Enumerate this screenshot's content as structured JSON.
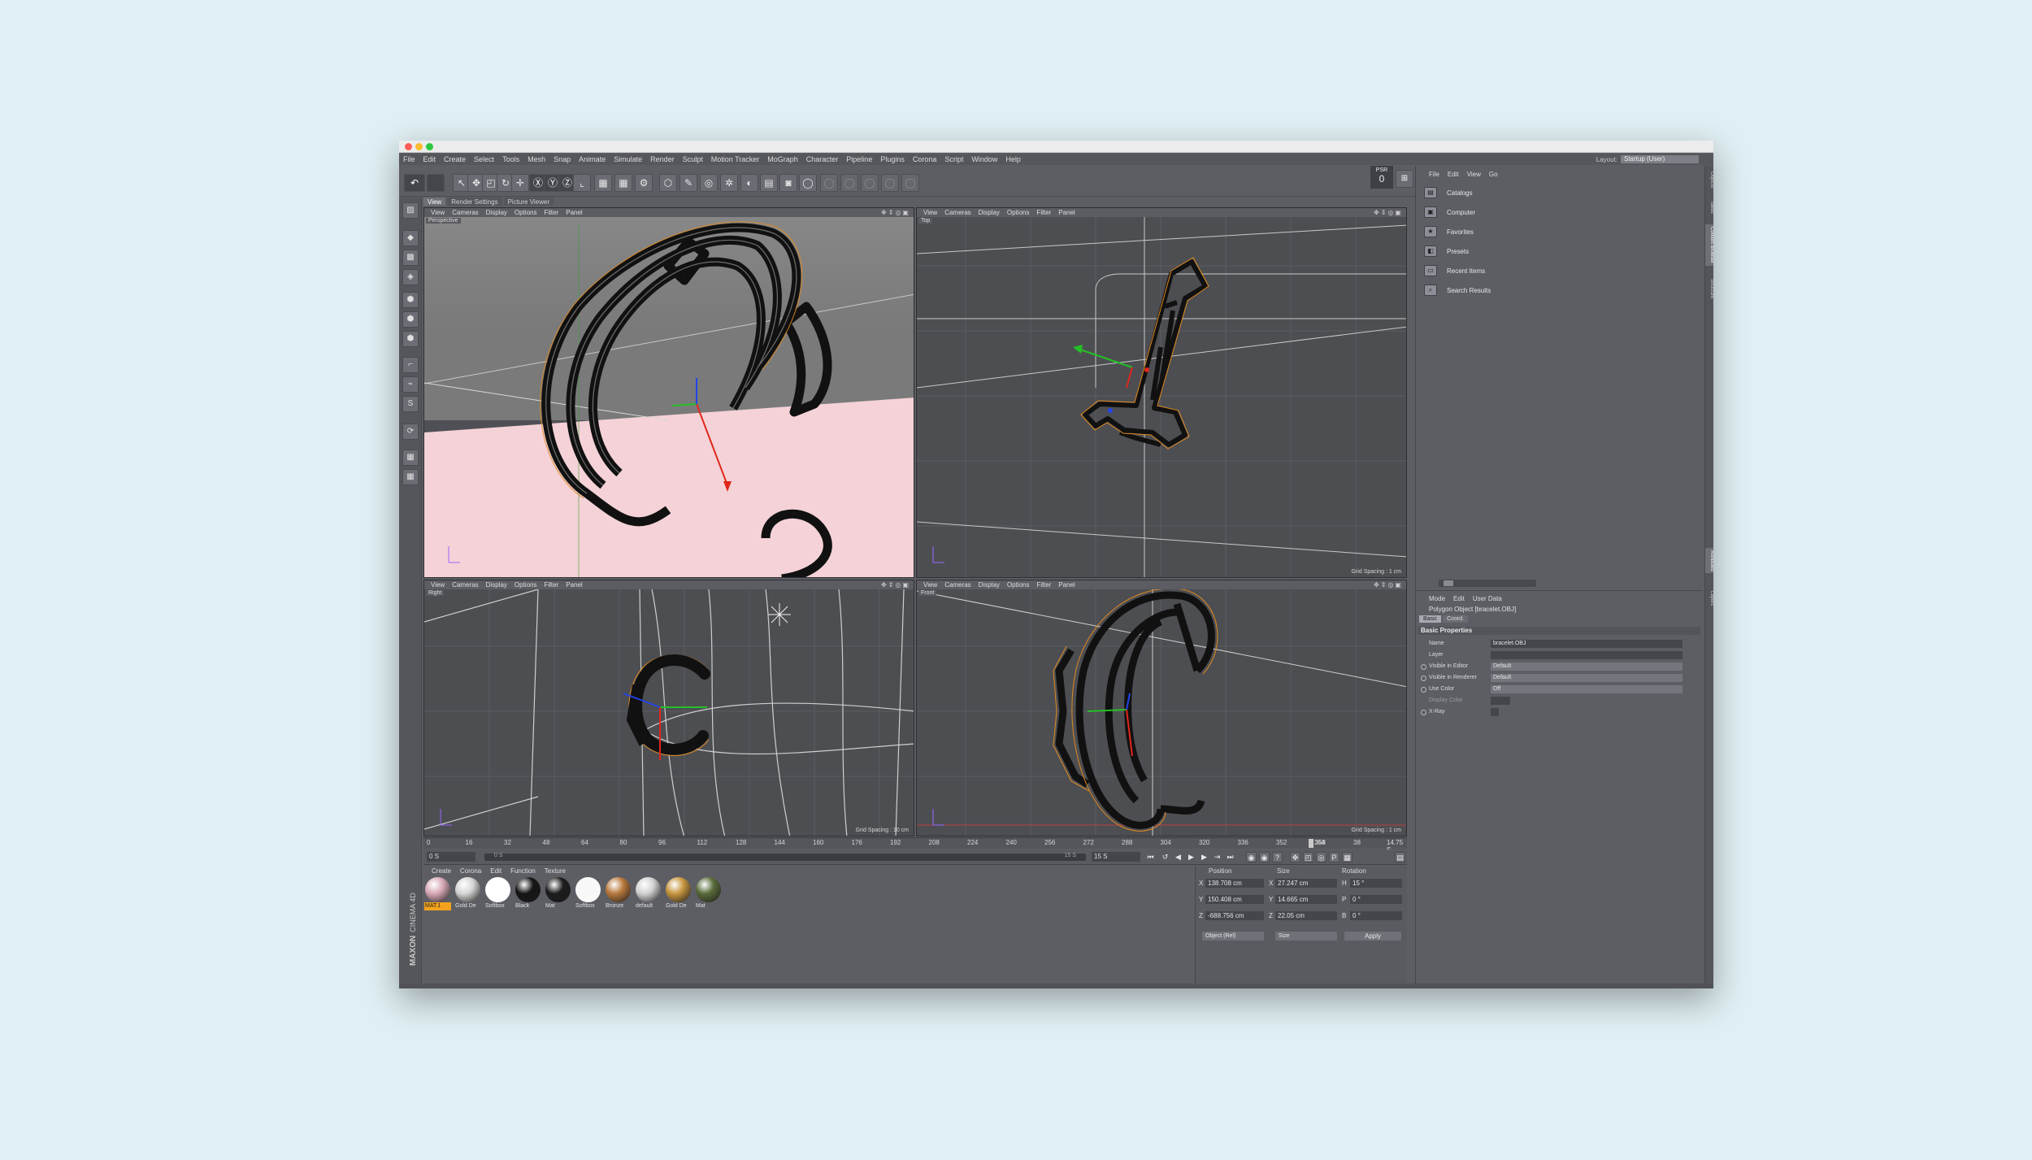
{
  "menubar": [
    "File",
    "Edit",
    "Create",
    "Select",
    "Tools",
    "Mesh",
    "Snap",
    "Animate",
    "Simulate",
    "Render",
    "Sculpt",
    "Motion Tracker",
    "MoGraph",
    "Character",
    "Pipeline",
    "Plugins",
    "Corona",
    "Script",
    "Window",
    "Help"
  ],
  "layout": {
    "label": "Layout:",
    "value": "Startup (User)"
  },
  "psr": {
    "label": "PSR",
    "value": "0"
  },
  "viewport_tabs": [
    "View",
    "Render Settings",
    "Picture Viewer"
  ],
  "viewport_menu": [
    "View",
    "Cameras",
    "Display",
    "Options",
    "Filter",
    "Panel"
  ],
  "viewports": {
    "perspective": {
      "label": "Perspective",
      "footer": ""
    },
    "top": {
      "label": "Top",
      "footer": "Grid Spacing : 1 cm"
    },
    "right": {
      "label": "Right",
      "footer": "Grid Spacing : 10 cm"
    },
    "front": {
      "label": "Front",
      "footer": "Grid Spacing : 1 cm"
    }
  },
  "timeline": {
    "ticks": [
      "0",
      "16",
      "32",
      "48",
      "64",
      "80",
      "96",
      "112",
      "128",
      "144",
      "160",
      "176",
      "192",
      "208",
      "224",
      "240",
      "256",
      "272",
      "288",
      "304",
      "320",
      "336",
      "352",
      "368",
      "38"
    ],
    "current_mark": "354",
    "current_frame": "14.75 S",
    "start": "0 S",
    "slider_start": "0 S",
    "slider_end": "15 S",
    "end": "15 S"
  },
  "material_menu": [
    "Create",
    "Corona",
    "Edit",
    "Function",
    "Texture"
  ],
  "materials": [
    {
      "name": "MAT.1",
      "color": "#d7a9b6",
      "selected": true
    },
    {
      "name": "Gold De",
      "color": "#d5d5d5",
      "selected": false
    },
    {
      "name": "Softbox",
      "color": "#ffffff",
      "selected": false
    },
    {
      "name": "Black",
      "color": "#151515",
      "selected": false
    },
    {
      "name": "Mat",
      "color": "#1c1c1c",
      "selected": false
    },
    {
      "name": "Softbox",
      "color": "#f8f8f8",
      "selected": false
    },
    {
      "name": "Bronze",
      "color": "#b8793d",
      "selected": false
    },
    {
      "name": "default",
      "color": "#d2d2d2",
      "selected": false
    },
    {
      "name": "Gold De",
      "color": "#c7963f",
      "selected": false
    },
    {
      "name": "Mat",
      "color": "#5a6b3a",
      "selected": false
    }
  ],
  "coords": {
    "headers": {
      "position": "Position",
      "size": "Size",
      "rotation": "Rotation"
    },
    "rows": [
      {
        "axis": "X",
        "position": "138.708 cm",
        "size_axis": "X",
        "size": "27.247 cm",
        "rot_axis": "H",
        "rotation": "15 °"
      },
      {
        "axis": "Y",
        "position": "150.408 cm",
        "size_axis": "Y",
        "size": "14.665 cm",
        "rot_axis": "P",
        "rotation": "0 °"
      },
      {
        "axis": "Z",
        "position": "-688.756 cm",
        "size_axis": "Z",
        "size": "22.05 cm",
        "rot_axis": "B",
        "rotation": "0 °"
      }
    ],
    "mode_select": "Object (Rel)",
    "size_select": "Size",
    "apply": "Apply"
  },
  "content_browser": {
    "menu": [
      "File",
      "Edit",
      "View",
      "Go"
    ],
    "items": [
      "Catalogs",
      "Computer",
      "Favorites",
      "Presets",
      "Recent Items",
      "Search Results"
    ]
  },
  "attributes": {
    "menu": [
      "Mode",
      "Edit",
      "User Data"
    ],
    "object": "Polygon Object [bracelet.OBJ]",
    "tabs": [
      "Basic",
      "Coord."
    ],
    "section": "Basic Properties",
    "fields": [
      {
        "label": "Name",
        "value": "bracelet.OBJ",
        "dot": false,
        "dim": false,
        "select": false
      },
      {
        "label": "Layer",
        "value": "",
        "dot": false,
        "dim": false,
        "select": false
      },
      {
        "label": "Visible in Editor",
        "value": "Default",
        "dot": true,
        "dim": false,
        "select": true
      },
      {
        "label": "Visible in Renderer",
        "value": "Default",
        "dot": true,
        "dim": false,
        "select": true
      },
      {
        "label": "Use Color",
        "value": "Off",
        "dot": true,
        "dim": false,
        "select": true
      },
      {
        "label": "Display Color",
        "value": "",
        "dot": false,
        "dim": true,
        "select": false
      },
      {
        "label": "X-Ray",
        "value": "",
        "dot": true,
        "dim": false,
        "select": false
      }
    ]
  },
  "right_vertical_tabs": [
    "Objects",
    "Takes",
    "Content Browser",
    "Structure",
    "Attributes",
    "Layers"
  ],
  "brand": {
    "name": "MAXON",
    "product": "CINEMA 4D"
  }
}
